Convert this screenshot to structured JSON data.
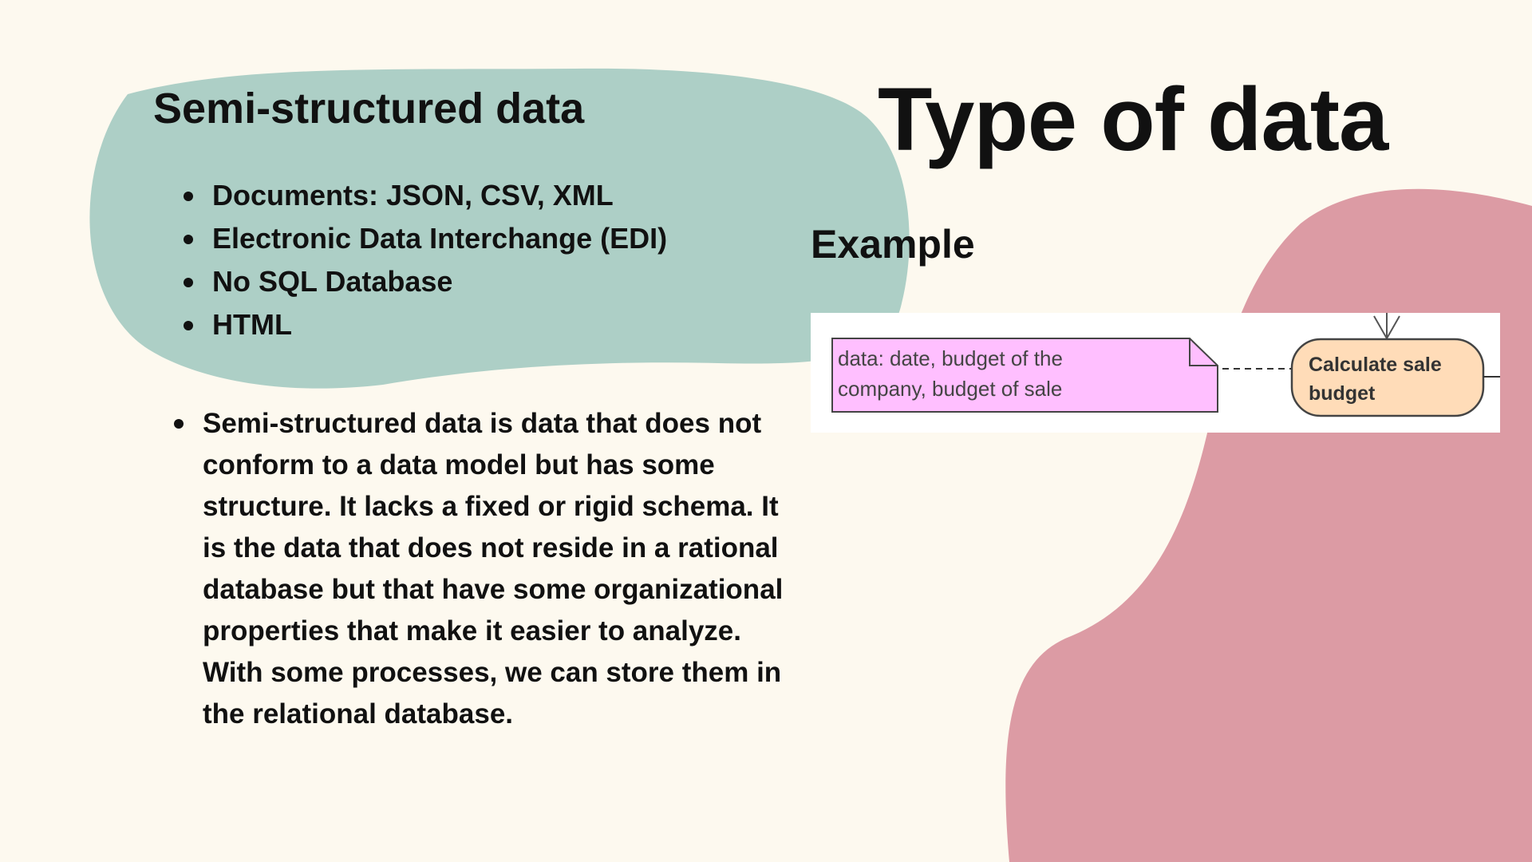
{
  "slide": {
    "title": "Type of data",
    "section_title": "Semi-structured data",
    "types": [
      "Documents: JSON, CSV, XML",
      "Electronic Data Interchange (EDI)",
      "No SQL Database",
      "HTML"
    ],
    "description": "Semi-structured data is data that does not conform to a data model but has some structure. It lacks a fixed or rigid schema. It is the data that does not reside in a rational database but that have some organizational properties that make it easier to analyze. With some processes, we can store them in the relational database.",
    "example_label": "Example"
  },
  "diagram": {
    "note_lines": [
      "data: date, budget of the",
      "company, budget of sale"
    ],
    "action_lines": [
      "Calculate sale",
      "budget"
    ]
  },
  "colors": {
    "background": "#fdf9ef",
    "teal_blob": "#adcfc6",
    "pink_blob": "#dc9ba4",
    "note_fill": "#ffbfff",
    "action_fill": "#ffdcb8",
    "text": "#111111"
  }
}
